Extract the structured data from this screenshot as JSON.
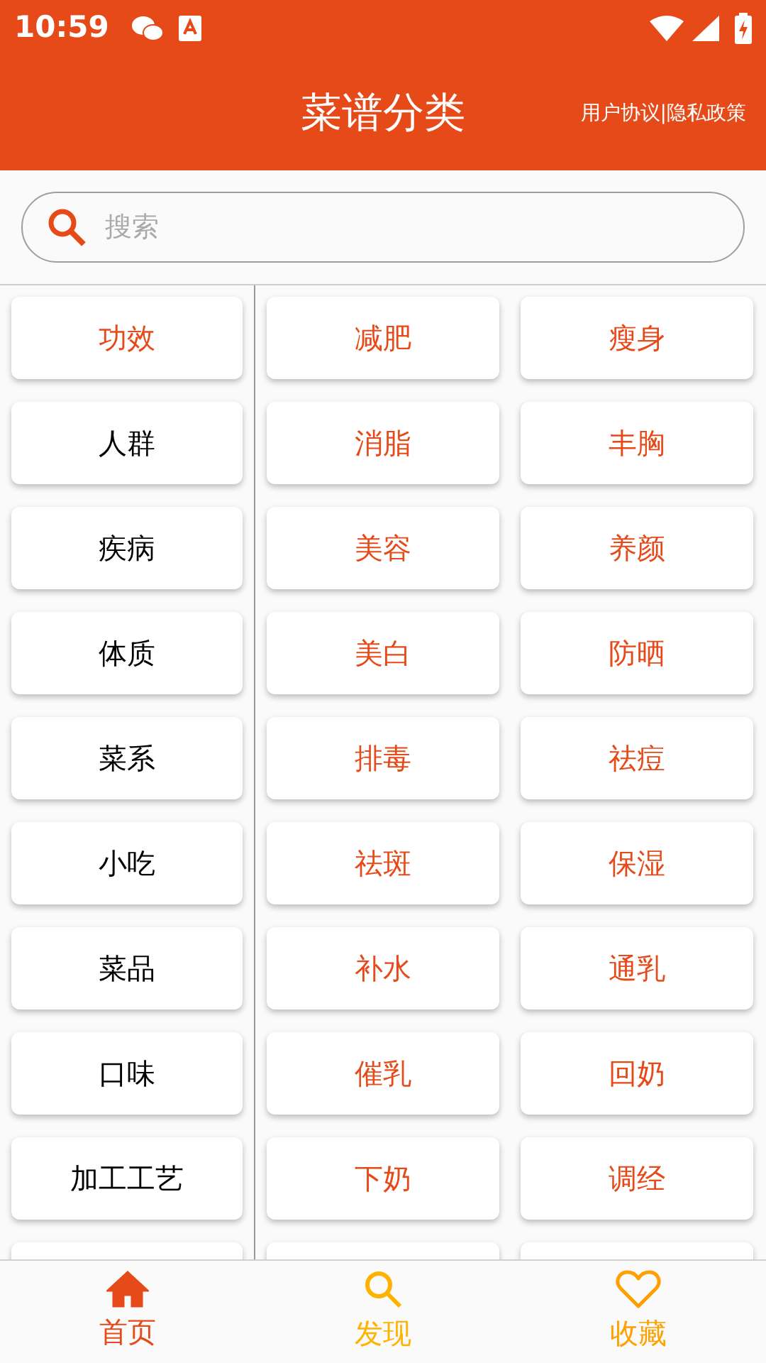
{
  "status_bar": {
    "time": "10:59"
  },
  "header": {
    "title": "菜谱分类",
    "link": "用户协议|隐私政策"
  },
  "search": {
    "placeholder": "搜索"
  },
  "categories": [
    {
      "label": "功效",
      "selected": true
    },
    {
      "label": "人群",
      "selected": false
    },
    {
      "label": "疾病",
      "selected": false
    },
    {
      "label": "体质",
      "selected": false
    },
    {
      "label": "菜系",
      "selected": false
    },
    {
      "label": "小吃",
      "selected": false
    },
    {
      "label": "菜品",
      "selected": false
    },
    {
      "label": "口味",
      "selected": false
    },
    {
      "label": "加工工艺",
      "selected": false
    }
  ],
  "subcategories": [
    "减肥",
    "瘦身",
    "消脂",
    "丰胸",
    "美容",
    "养颜",
    "美白",
    "防晒",
    "排毒",
    "祛痘",
    "祛斑",
    "保湿",
    "补水",
    "通乳",
    "催乳",
    "回奶",
    "下奶",
    "调经"
  ],
  "bottom_nav": [
    {
      "label": "首页",
      "kind": "home",
      "color": "#e64a19",
      "selected": true
    },
    {
      "label": "发现",
      "kind": "search",
      "color": "#ffb300",
      "selected": false
    },
    {
      "label": "收藏",
      "kind": "heart",
      "color": "#ffa000",
      "selected": false
    }
  ]
}
